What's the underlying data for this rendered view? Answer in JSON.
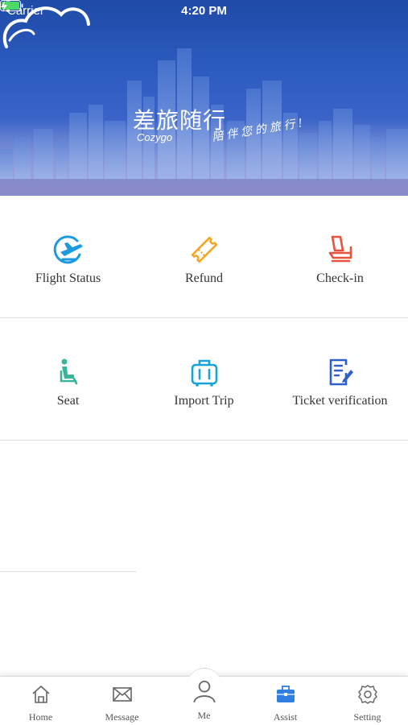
{
  "status_bar": {
    "carrier": "Carrier",
    "time": "4:20 PM"
  },
  "banner": {
    "logo_cn": "差旅随行",
    "logo_en": "Cozygo",
    "slogan": "陪伴您的旅行!"
  },
  "services": [
    {
      "label": "Flight Status",
      "icon": "plane-takeoff-icon",
      "color": "#1a9ae0"
    },
    {
      "label": "Refund",
      "icon": "ticket-icon",
      "color": "#f5a623"
    },
    {
      "label": "Check-in",
      "icon": "seat-icon",
      "color": "#e8533d"
    },
    {
      "label": "Seat",
      "icon": "person-seat-icon",
      "color": "#3bb59a"
    },
    {
      "label": "Import Trip",
      "icon": "luggage-icon",
      "color": "#18a4d8"
    },
    {
      "label": "Ticket verification",
      "icon": "document-edit-icon",
      "color": "#2f5fc9"
    }
  ],
  "tabbar": {
    "tabs": [
      {
        "label": "Home",
        "icon": "home-icon"
      },
      {
        "label": "Message",
        "icon": "envelope-icon"
      },
      {
        "label": "Me",
        "icon": "user-icon"
      },
      {
        "label": "Assist",
        "icon": "briefcase-icon"
      },
      {
        "label": "Setting",
        "icon": "gear-icon"
      }
    ],
    "active_color": "#2f7fe0"
  }
}
